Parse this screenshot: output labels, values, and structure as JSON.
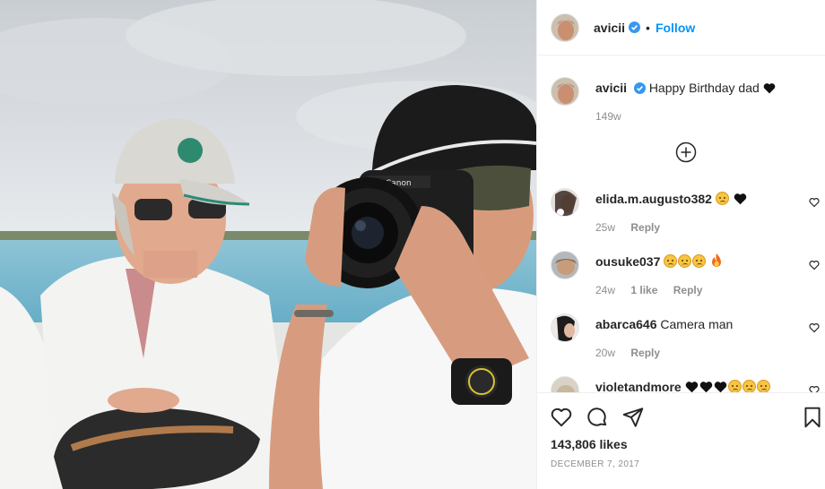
{
  "post": {
    "username": "avicii",
    "separator": "•",
    "follow_label": "Follow",
    "caption": "Happy Birthday dad",
    "caption_age": "149w",
    "likes": "143,806 likes",
    "date": "DECEMBER 7, 2017"
  },
  "comments": [
    {
      "username": "elida.m.augusto382",
      "text": "",
      "emoji": [
        "sad-face-emoji",
        "black-heart-emoji"
      ],
      "age": "25w",
      "likes": "",
      "reply_label": "Reply"
    },
    {
      "username": "ousuke037",
      "text": "",
      "emoji": [
        "sad-face-emoji",
        "sad-face-emoji",
        "sad-face-emoji",
        "fire-emoji"
      ],
      "age": "24w",
      "likes": "1 like",
      "reply_label": "Reply"
    },
    {
      "username": "abarca646",
      "text": "Camera man",
      "emoji": [],
      "age": "20w",
      "likes": "",
      "reply_label": "Reply"
    },
    {
      "username": "violetandmore",
      "text": "",
      "emoji": [
        "black-heart-emoji",
        "black-heart-emoji",
        "black-heart-emoji",
        "sad-face-emoji",
        "sad-face-emoji",
        "sad-face-emoji"
      ],
      "age": "",
      "likes": "",
      "reply_label": ""
    }
  ],
  "icons": {
    "verified": "verified-badge-icon",
    "load_more": "plus-circle-icon",
    "like": "heart-icon",
    "comment": "comment-icon",
    "share": "paper-plane-icon",
    "save": "bookmark-icon"
  },
  "colors": {
    "accent": "#0095f6",
    "text": "#262626",
    "muted": "#8e8e8e",
    "border": "#efefef"
  }
}
